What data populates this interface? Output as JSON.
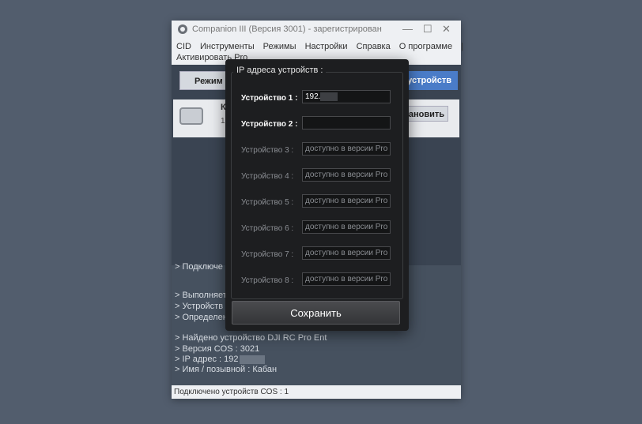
{
  "window": {
    "title": "Companion III (Версия 3001) - зарегистрирован",
    "minimize": "—",
    "maximize": "☐",
    "close": "✕"
  },
  "menu": {
    "items": [
      "CID",
      "Инструменты",
      "Режимы",
      "Настройки",
      "Справка",
      "О программе",
      "|"
    ],
    "activate": "Активировать Pro"
  },
  "toolbar": {
    "mode_button": "Режим р",
    "devices_button": "а устройств"
  },
  "device_card": {
    "name": "К",
    "sub": "1",
    "install_button": "тановить"
  },
  "log": {
    "lines": [
      "> Подключе",
      "",
      "> Выполняет",
      "> Устройств",
      "> Определен",
      "",
      "> Найдено устройство DJI RC Pro Ent",
      "> Версия COS : 3021",
      "> IP адрес : 192",
      "> Имя / позывной : Кабан"
    ]
  },
  "status": {
    "text": "Подключено устройств COS : 1"
  },
  "dialog": {
    "group_title": "IP адреса устройств :",
    "devices": [
      {
        "label": "Устройство 1 :",
        "value": "192.",
        "enabled": true
      },
      {
        "label": "Устройство 2 :",
        "value": "",
        "enabled": true
      },
      {
        "label": "Устройство 3 :",
        "value": "доступно в версии Pro",
        "enabled": false
      },
      {
        "label": "Устройство 4 :",
        "value": "доступно в версии Pro",
        "enabled": false
      },
      {
        "label": "Устройство 5 :",
        "value": "доступно в версии Pro",
        "enabled": false
      },
      {
        "label": "Устройство 6 :",
        "value": "доступно в версии Pro",
        "enabled": false
      },
      {
        "label": "Устройство 7 :",
        "value": "доступно в версии Pro",
        "enabled": false
      },
      {
        "label": "Устройство 8 :",
        "value": "доступно в версии Pro",
        "enabled": false
      }
    ],
    "save_button": "Сохранить"
  },
  "colors": {
    "desktop": "#525d6d",
    "dialog_bg": "#1d1e20",
    "accent_blue": "#4a7cc8"
  }
}
